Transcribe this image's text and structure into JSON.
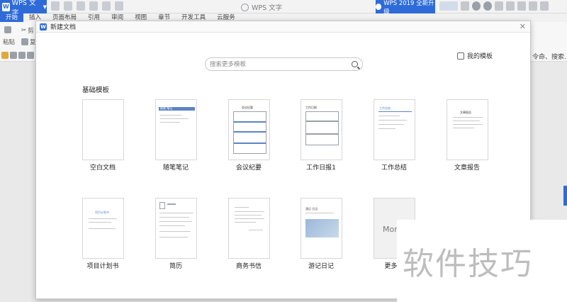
{
  "titlebar": {
    "app_name": "WPS 文字",
    "window_title": "WPS 文字",
    "upgrade_label": "WPS 2019 全新升级"
  },
  "ribbon_tabs": [
    "开始",
    "插入",
    "页面布局",
    "引用",
    "审阅",
    "视图",
    "章节",
    "开发工具",
    "云服务"
  ],
  "ribbon": {
    "cut_label": "剪",
    "paste_label": "粘贴",
    "copy_label": "复",
    "command_search": "令命、搜索..."
  },
  "dialog": {
    "title": "新建文档",
    "close_icon": "close-icon",
    "search_placeholder": "搜索更多模板",
    "my_templates_label": "我的模板",
    "section_title": "基础模板",
    "templates": [
      {
        "label": "空白文档"
      },
      {
        "label": "随笔笔记"
      },
      {
        "label": "会议纪要"
      },
      {
        "label": "工作日报1"
      },
      {
        "label": "工作总结"
      },
      {
        "label": "文章报告"
      },
      {
        "label": "项目计划书"
      },
      {
        "label": "简历"
      },
      {
        "label": "商务书信"
      },
      {
        "label": "游记日记"
      },
      {
        "label": "更多模"
      }
    ],
    "more_card_text": "More",
    "thumb_text": {
      "notes_title": "随笔 笔记",
      "meeting_title": "会议纪要",
      "daily_title": "工作日报",
      "summary_title": "工作总结",
      "report_title": "文章报告",
      "plan_title": "项目计划书",
      "travel_title": "游记 日记"
    }
  },
  "watermark": "软件技巧",
  "colors": {
    "accent": "#2f6bd8",
    "thumb_blue": "#5b84c7"
  }
}
